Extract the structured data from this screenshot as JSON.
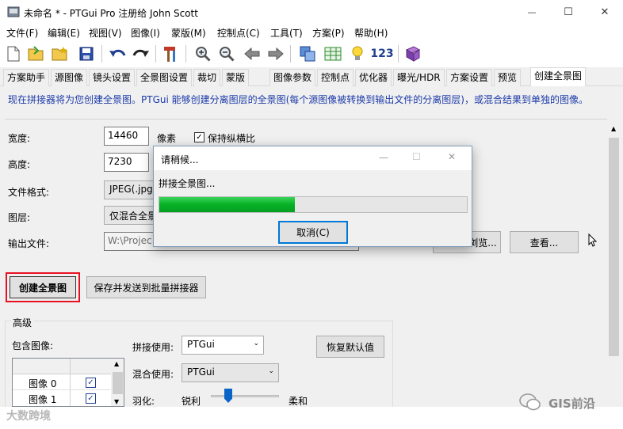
{
  "window": {
    "title": "未命名 * - PTGui Pro 注册给 John Scott",
    "controls": {
      "minimize": "—",
      "maximize": "☐",
      "close": "✕"
    }
  },
  "menu": [
    "文件(F)",
    "编辑(E)",
    "视图(V)",
    "图像(I)",
    "蒙版(M)",
    "控制点(C)",
    "工具(T)",
    "方案(P)",
    "帮助(H)"
  ],
  "toolbar": {
    "count_label": "123"
  },
  "tabs": [
    "方案助手",
    "源图像",
    "镜头设置",
    "全景图设置",
    "裁切",
    "蒙版",
    "图像参数",
    "控制点",
    "优化器",
    "曝光/HDR",
    "方案设置",
    "预览",
    "创建全景图"
  ],
  "active_tab": "创建全景图",
  "info": "现在拼接器将为您创建全景图。PTGui 能够创建分离图层的全景图(每个源图像被转换到输出文件的分离图层)，或混合结果到单独的图像。",
  "form": {
    "width_label": "宽度:",
    "width_value": "14460",
    "pixels_label": "像素",
    "keep_aspect_label": "保持纵横比",
    "keep_aspect_checked": true,
    "height_label": "高度:",
    "height_value": "7230",
    "format_label": "文件格式:",
    "format_value": "JPEG(.jpg)",
    "layers_label": "图层:",
    "layers_value": "仅混合全景",
    "output_label": "输出文件:",
    "output_value": "W:\\Projec",
    "browse_label": "浏览...",
    "view_label": "查看..."
  },
  "actions": {
    "create_label": "创建全景图",
    "save_batch_label": "保存并发送到批量拼接器"
  },
  "advanced": {
    "title": "高级",
    "include_images_label": "包含图像:",
    "images": [
      {
        "name": "图像 0",
        "checked": true
      },
      {
        "name": "图像 1",
        "checked": true
      }
    ],
    "stitch_with_label": "拼接使用:",
    "stitch_with_value": "PTGui",
    "blend_with_label": "混合使用:",
    "blend_with_value": "PTGui",
    "restore_defaults_label": "恢复默认值",
    "feather_label": "羽化:",
    "sharp_label": "锐利",
    "soft_label": "柔和"
  },
  "dialog": {
    "title": "请稍候...",
    "message": "拼接全景图...",
    "progress": 0.44,
    "cancel_label": "取消(C)"
  },
  "watermarks": {
    "left": "大数跨境",
    "right": "GIS前沿"
  },
  "colors": {
    "info_text": "#1c3aa9",
    "progress": "#06b025",
    "highlight_border": "#e81123"
  }
}
